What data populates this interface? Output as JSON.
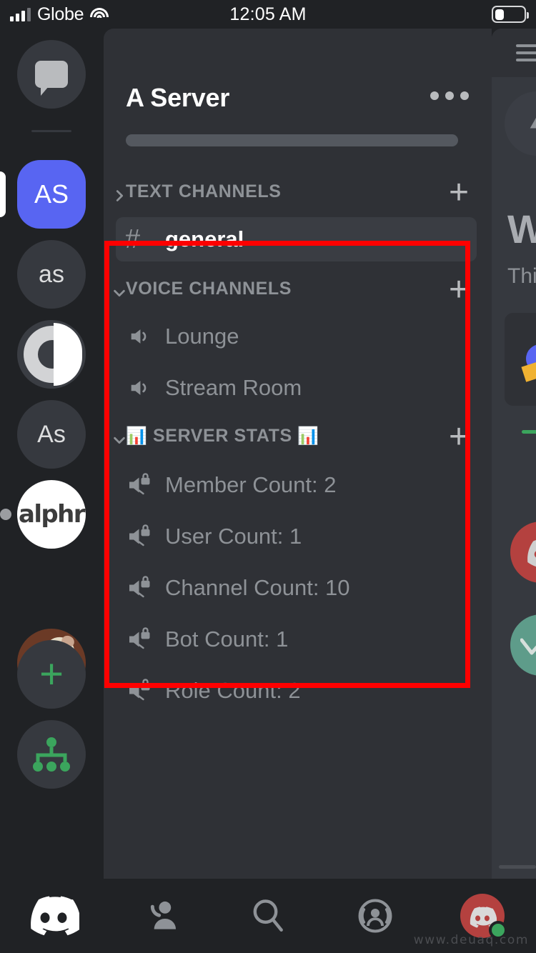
{
  "status_bar": {
    "carrier": "Globe",
    "time": "12:05 AM",
    "signal_icon": "cellular-signal-icon",
    "wifi_icon": "wifi-icon",
    "battery_icon": "battery-low-icon"
  },
  "server_rail": {
    "items": [
      {
        "name": "direct-messages",
        "label": "",
        "icon": "chat-bubble-icon",
        "type": "dm",
        "selected": false,
        "unread": false
      },
      {
        "name": "server-as-blue",
        "label": "AS",
        "icon": "",
        "type": "initials",
        "selected": true,
        "unread": false
      },
      {
        "name": "server-as-lower",
        "label": "as",
        "icon": "",
        "type": "initials",
        "selected": false,
        "unread": false
      },
      {
        "name": "server-eye",
        "label": "",
        "icon": "circle-eye-icon",
        "type": "image",
        "selected": false,
        "unread": false
      },
      {
        "name": "server-as-caps",
        "label": "As",
        "icon": "",
        "type": "initials",
        "selected": false,
        "unread": false
      },
      {
        "name": "server-alphr",
        "label": "alphr",
        "icon": "",
        "type": "logo",
        "selected": false,
        "unread": true
      },
      {
        "name": "server-dog",
        "label": "",
        "icon": "dog-photo-avatar",
        "type": "image",
        "selected": false,
        "unread": false
      },
      {
        "name": "add-server",
        "label": "+",
        "icon": "plus-icon",
        "type": "action",
        "selected": false,
        "unread": false
      },
      {
        "name": "explore-servers",
        "label": "",
        "icon": "server-discovery-icon",
        "type": "action",
        "selected": false,
        "unread": false
      }
    ]
  },
  "server_panel": {
    "title": "A Server",
    "more_options_icon": "more-options-icon",
    "search_placeholder": "",
    "categories": [
      {
        "name": "text-channels",
        "label": "TEXT CHANNELS",
        "emoji_left": "",
        "emoji_right": "",
        "collapsed": true,
        "chevron": "chevron-right-icon",
        "add_label": "+",
        "channels": [
          {
            "name": "general",
            "label": "general",
            "icon": "hash-icon",
            "active": true
          }
        ]
      },
      {
        "name": "voice-channels",
        "label": "VOICE CHANNELS",
        "emoji_left": "",
        "emoji_right": "",
        "collapsed": false,
        "chevron": "chevron-down-icon",
        "add_label": "+",
        "channels": [
          {
            "name": "lounge",
            "label": "Lounge",
            "icon": "speaker-icon",
            "active": false
          },
          {
            "name": "stream-room",
            "label": "Stream Room",
            "icon": "speaker-icon",
            "active": false
          }
        ]
      },
      {
        "name": "server-stats",
        "label": "SERVER STATS",
        "emoji_left": "📊",
        "emoji_right": "📊",
        "collapsed": false,
        "chevron": "chevron-down-icon",
        "add_label": "+",
        "channels": [
          {
            "name": "member-count",
            "label": "Member Count: 2",
            "icon": "locked-speaker-icon",
            "active": false
          },
          {
            "name": "user-count",
            "label": "User Count: 1",
            "icon": "locked-speaker-icon",
            "active": false
          },
          {
            "name": "channel-count",
            "label": "Channel Count: 10",
            "icon": "locked-speaker-icon",
            "active": false
          },
          {
            "name": "bot-count",
            "label": "Bot Count: 1",
            "icon": "locked-speaker-icon",
            "active": false
          },
          {
            "name": "role-count",
            "label": "Role Count: 2",
            "icon": "locked-speaker-icon",
            "active": false
          }
        ]
      }
    ]
  },
  "chat_preview": {
    "menu_icon": "hamburger-menu-icon",
    "title": "W",
    "subtitle": "Thi"
  },
  "annotation": {
    "color": "#ff0000",
    "target": "voice-channels-and-server-stats"
  },
  "bottom_nav": {
    "items": [
      {
        "name": "nav-servers",
        "icon": "discord-logo-icon",
        "active": true
      },
      {
        "name": "nav-friends",
        "icon": "friends-icon",
        "active": false
      },
      {
        "name": "nav-search",
        "icon": "search-icon",
        "active": false
      },
      {
        "name": "nav-live",
        "icon": "stage-live-icon",
        "active": false
      },
      {
        "name": "nav-profile",
        "icon": "user-avatar-icon",
        "active": false
      }
    ]
  },
  "watermark": "www.deuaq.com"
}
